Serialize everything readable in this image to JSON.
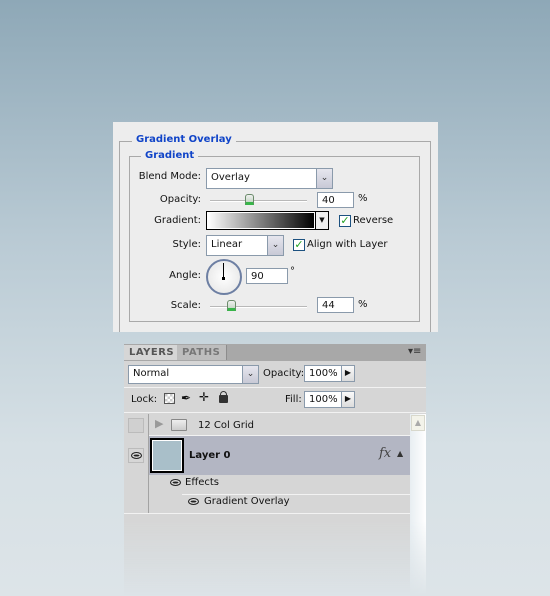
{
  "dialog": {
    "section_title": "Gradient Overlay",
    "group_title": "Gradient",
    "blend_mode": {
      "label": "Blend Mode:",
      "value": "Overlay"
    },
    "opacity": {
      "label": "Opacity:",
      "value": "40",
      "unit": "%",
      "slider_percent": 40
    },
    "gradient": {
      "label": "Gradient:",
      "reverse_label": "Reverse",
      "reverse_checked": true
    },
    "style": {
      "label": "Style:",
      "value": "Linear",
      "align_label": "Align with Layer",
      "align_checked": true
    },
    "angle": {
      "label": "Angle:",
      "value": "90",
      "unit": "°"
    },
    "scale": {
      "label": "Scale:",
      "value": "44",
      "unit": "%",
      "slider_percent": 22
    }
  },
  "layers_panel": {
    "tabs": [
      {
        "label": "LAYERS",
        "active": true
      },
      {
        "label": "PATHS",
        "active": false
      }
    ],
    "blend_mode": "Normal",
    "opacity_label": "Opacity:",
    "opacity_value": "100%",
    "lock_label": "Lock:",
    "fill_label": "Fill:",
    "fill_value": "100%",
    "layers": [
      {
        "name": "12 Col Grid",
        "type": "group",
        "visible": false
      },
      {
        "name": "Layer 0",
        "type": "layer",
        "visible": true,
        "selected": true,
        "fx": "fx",
        "thumbnail_color": "#a9bfc9"
      }
    ],
    "effects_label": "Effects",
    "effects": [
      "Gradient Overlay"
    ]
  }
}
